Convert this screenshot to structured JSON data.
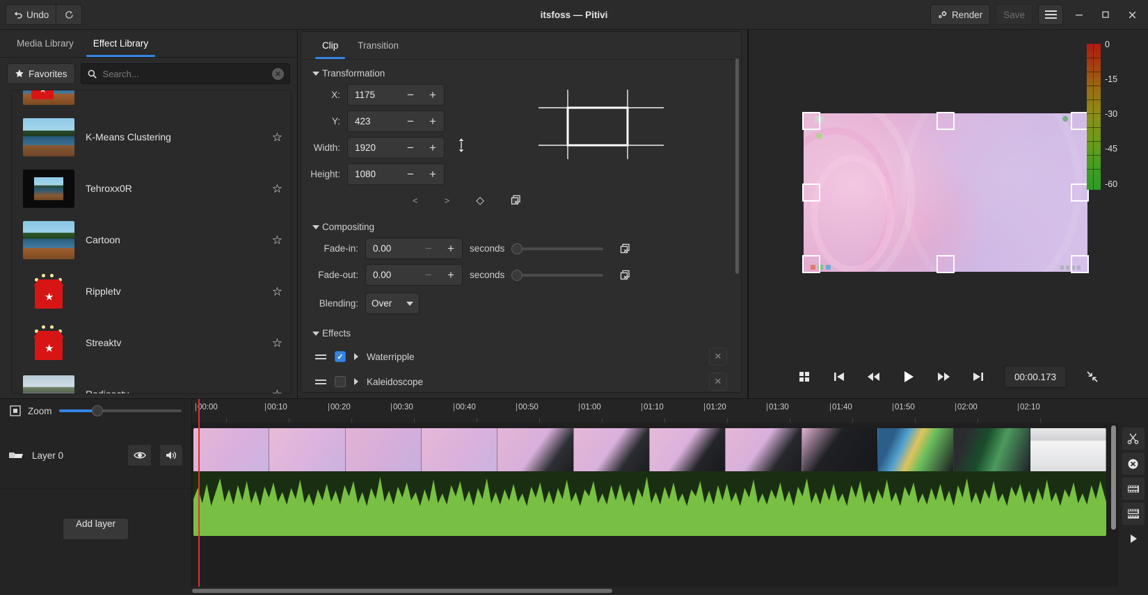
{
  "window": {
    "title": "itsfoss — Pitivi",
    "undo_label": "Undo",
    "redo_icon": "redo-icon",
    "render_label": "Render",
    "save_label": "Save",
    "menu_icon": "hamburger-menu-icon",
    "minimize_icon": "minimize-icon",
    "maximize_icon": "maximize-icon",
    "close_icon": "close-icon"
  },
  "left_panel": {
    "tabs": [
      {
        "label": "Media Library",
        "active": false
      },
      {
        "label": "Effect Library",
        "active": true
      }
    ],
    "favorites_label": "Favorites",
    "favorites_icon": "star-icon",
    "search": {
      "placeholder": "Search...",
      "value": "",
      "icon": "search-icon",
      "clear_icon": "clear-icon"
    },
    "effects": [
      {
        "name": "K-Means Clustering",
        "thumb": "lake",
        "fav_icon": "star-outline-icon"
      },
      {
        "name": "Tehroxx0R",
        "thumb": "tehroxx",
        "fav_icon": "star-outline-icon"
      },
      {
        "name": "Cartoon",
        "thumb": "cartoon",
        "fav_icon": "star-outline-icon"
      },
      {
        "name": "Rippletv",
        "thumb": "tv",
        "fav_icon": "star-outline-icon"
      },
      {
        "name": "Streaktv",
        "thumb": "tv",
        "fav_icon": "star-outline-icon"
      },
      {
        "name": "Radioactv",
        "thumb": "radio",
        "fav_icon": "star-outline-icon"
      }
    ]
  },
  "clip_properties": {
    "tabs": [
      {
        "label": "Clip",
        "active": true
      },
      {
        "label": "Transition",
        "active": false
      }
    ],
    "transformation": {
      "title": "Transformation",
      "fields": [
        {
          "label": "X:",
          "value": "1175"
        },
        {
          "label": "Y:",
          "value": "423"
        },
        {
          "label": "Width:",
          "value": "1920"
        },
        {
          "label": "Height:",
          "value": "1080"
        }
      ],
      "keyframe_prev": "<",
      "keyframe_next": ">",
      "keyframe_add": "◇",
      "reset_icon": "reset-keyframes-icon",
      "move_icon": "move-handle-icon"
    },
    "compositing": {
      "title": "Compositing",
      "fade_in": {
        "label": "Fade-in:",
        "value": "0.00",
        "unit": "seconds"
      },
      "fade_out": {
        "label": "Fade-out:",
        "value": "0.00",
        "unit": "seconds"
      },
      "blending": {
        "label": "Blending:",
        "value": "Over"
      },
      "reset_icon": "reset-icon"
    },
    "effects_section": {
      "title": "Effects",
      "items": [
        {
          "name": "Waterripple",
          "enabled": true,
          "remove_icon": "remove-icon",
          "expand_icon": "chevron-right-icon",
          "drag_icon": "drag-handle-icon"
        },
        {
          "name": "Kaleidoscope",
          "enabled": false,
          "remove_icon": "remove-icon",
          "expand_icon": "chevron-right-icon",
          "drag_icon": "drag-handle-icon"
        }
      ]
    }
  },
  "viewer": {
    "timecode": "00:00.173",
    "controls": [
      {
        "name": "view-modes-button",
        "icon": "grid-icon"
      },
      {
        "name": "go-start-button",
        "icon": "skip-backward-icon"
      },
      {
        "name": "rewind-button",
        "icon": "rewind-icon"
      },
      {
        "name": "play-button",
        "icon": "play-icon"
      },
      {
        "name": "forward-button",
        "icon": "fast-forward-icon"
      },
      {
        "name": "go-end-button",
        "icon": "skip-forward-icon"
      },
      {
        "name": "undock-button",
        "icon": "collapse-icon"
      }
    ],
    "meter_labels": [
      "0",
      "-15",
      "-30",
      "-45",
      "-60"
    ]
  },
  "timeline": {
    "zoom_label": "Zoom",
    "zoom_icon": "zoom-fit-icon",
    "zoom_value": 27,
    "ruler_ticks": [
      "00:00",
      "00:10",
      "00:20",
      "00:30",
      "00:40",
      "00:50",
      "01:00",
      "01:10",
      "01:20",
      "01:30",
      "01:40",
      "01:50",
      "02:00",
      "02:10"
    ],
    "layers": [
      {
        "name": "Layer 0",
        "visible_icon": "eye-icon",
        "audio_icon": "speaker-icon",
        "menu_icon": "layer-menu-icon"
      }
    ],
    "add_layer_label": "Add layer",
    "tools": [
      {
        "name": "split-clip-button",
        "icon": "scissors-icon"
      },
      {
        "name": "delete-clip-button",
        "icon": "delete-circle-icon"
      },
      {
        "name": "group-clips-button",
        "icon": "group-icon"
      },
      {
        "name": "ungroup-clips-button",
        "icon": "ungroup-icon"
      },
      {
        "name": "align-clips-button",
        "icon": "play-small-icon"
      }
    ]
  },
  "colors": {
    "accent": "#3584e4",
    "playhead": "#e03131",
    "audio_waveform": "#78c043",
    "bg": "#242424"
  }
}
